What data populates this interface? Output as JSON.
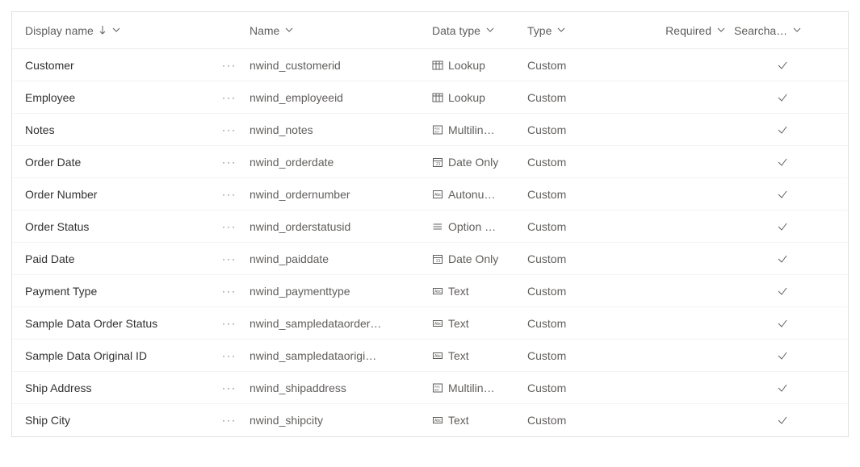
{
  "columns": {
    "displayName": "Display name",
    "name": "Name",
    "dataType": "Data type",
    "type": "Type",
    "required": "Required",
    "searchable": "Searcha…"
  },
  "sortedColumn": "displayName",
  "sortDirection": "asc",
  "rows": [
    {
      "displayName": "Customer",
      "name": "nwind_customerid",
      "dataType": "Lookup",
      "dataTypeIcon": "lookup",
      "type": "Custom",
      "required": "",
      "searchable": true
    },
    {
      "displayName": "Employee",
      "name": "nwind_employeeid",
      "dataType": "Lookup",
      "dataTypeIcon": "lookup",
      "type": "Custom",
      "required": "",
      "searchable": true
    },
    {
      "displayName": "Notes",
      "name": "nwind_notes",
      "dataType": "Multilin…",
      "dataTypeIcon": "multiline",
      "type": "Custom",
      "required": "",
      "searchable": true
    },
    {
      "displayName": "Order Date",
      "name": "nwind_orderdate",
      "dataType": "Date Only",
      "dataTypeIcon": "date",
      "type": "Custom",
      "required": "",
      "searchable": true
    },
    {
      "displayName": "Order Number",
      "name": "nwind_ordernumber",
      "dataType": "Autonu…",
      "dataTypeIcon": "autonum",
      "type": "Custom",
      "required": "",
      "searchable": true
    },
    {
      "displayName": "Order Status",
      "name": "nwind_orderstatusid",
      "dataType": "Option …",
      "dataTypeIcon": "optionset",
      "type": "Custom",
      "required": "",
      "searchable": true
    },
    {
      "displayName": "Paid Date",
      "name": "nwind_paiddate",
      "dataType": "Date Only",
      "dataTypeIcon": "date",
      "type": "Custom",
      "required": "",
      "searchable": true
    },
    {
      "displayName": "Payment Type",
      "name": "nwind_paymenttype",
      "dataType": "Text",
      "dataTypeIcon": "text",
      "type": "Custom",
      "required": "",
      "searchable": true
    },
    {
      "displayName": "Sample Data Order Status",
      "name": "nwind_sampledataorder…",
      "dataType": "Text",
      "dataTypeIcon": "text",
      "type": "Custom",
      "required": "",
      "searchable": true
    },
    {
      "displayName": "Sample Data Original ID",
      "name": "nwind_sampledataorigi…",
      "dataType": "Text",
      "dataTypeIcon": "text",
      "type": "Custom",
      "required": "",
      "searchable": true
    },
    {
      "displayName": "Ship Address",
      "name": "nwind_shipaddress",
      "dataType": "Multilin…",
      "dataTypeIcon": "multiline",
      "type": "Custom",
      "required": "",
      "searchable": true
    },
    {
      "displayName": "Ship City",
      "name": "nwind_shipcity",
      "dataType": "Text",
      "dataTypeIcon": "text",
      "type": "Custom",
      "required": "",
      "searchable": true
    }
  ]
}
